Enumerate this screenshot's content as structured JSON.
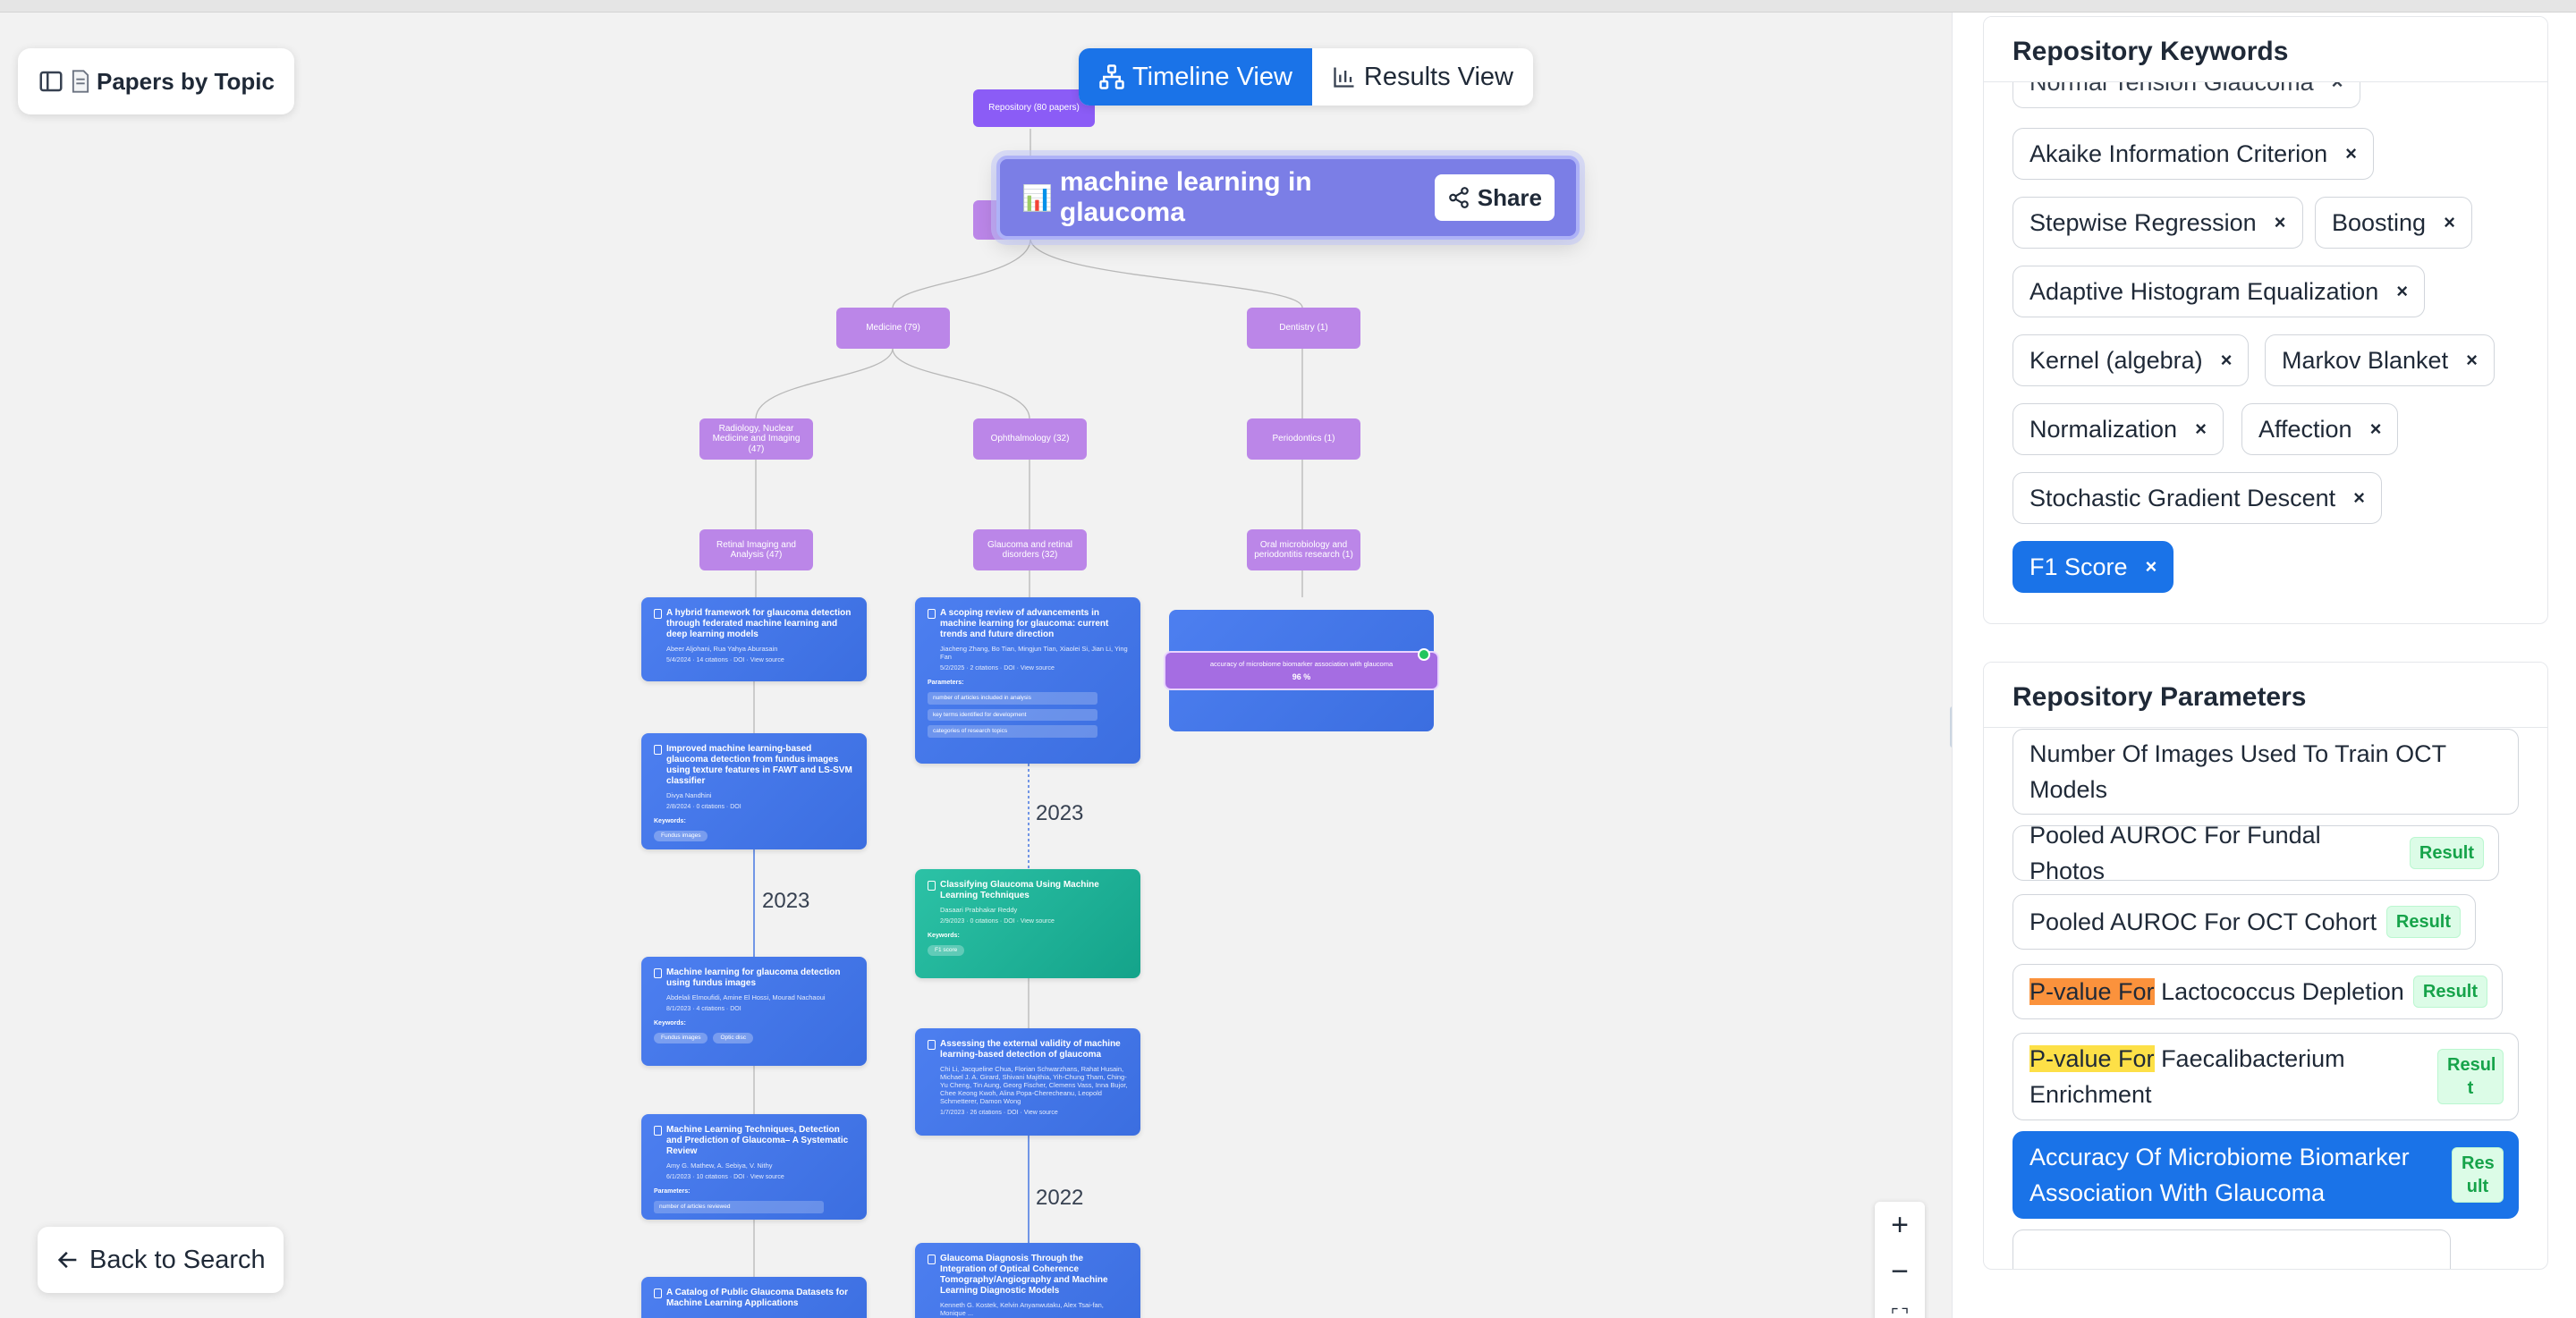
{
  "topic_button": {
    "label": "Papers by Topic"
  },
  "view_toggle": {
    "timeline": "Timeline View",
    "results": "Results View"
  },
  "popup": {
    "icon": "📊",
    "title": "machine learning in glaucoma",
    "share": "Share"
  },
  "tree": {
    "root": "Repository (80 papers)",
    "medicine": "Medicine (79)",
    "dentistry": "Dentistry (1)",
    "radiology": "Radiology, Nuclear Medicine and Imaging (47)",
    "ophthalmology": "Ophthalmology (32)",
    "periodontics": "Periodontics (1)",
    "retinal": "Retinal Imaging and Analysis (47)",
    "glaucoma": "Glaucoma and retinal disorders (32)",
    "oral": "Oral microbiology and periodontitis research (1)"
  },
  "years": [
    "2023",
    "2023",
    "2022"
  ],
  "papers": [
    {
      "title": "A hybrid framework for glaucoma detection through federated machine learning and deep learning models",
      "authors": "Abeer Aljohani, Rua Yahya Aburasain",
      "stats": "5/4/2024 · 14 citations · DOI · View source"
    },
    {
      "title": "Improved machine learning-based glaucoma detection from fundus images using texture features in FAWT and LS-SVM classifier",
      "authors": "Divya Nandhini",
      "stats": "2/8/2024 · 0 citations · DOI",
      "keywords_label": "Keywords:",
      "keywords": [
        "Fundus images"
      ]
    },
    {
      "title": "Machine learning for glaucoma detection using fundus images",
      "authors": "Abdelali Elmoufidi, Amine El Hossi, Mourad Nachaoui",
      "stats": "8/1/2023 · 4 citations · DOI",
      "keywords_label": "Keywords:",
      "keywords": [
        "Fundus images",
        "Optic disc"
      ]
    },
    {
      "title": "Machine Learning Techniques, Detection and Prediction of Glaucoma– A Systematic Review",
      "authors": "Amy G. Mathew, A. Sebiya, V. Nithy",
      "stats": "6/1/2023 · 10 citations · DOI · View source",
      "params_label": "Parameters:",
      "params": [
        "number of articles reviewed"
      ]
    },
    {
      "title": "A Catalog of Public Glaucoma Datasets for Machine Learning Applications"
    },
    {
      "title": "A scoping review of advancements in machine learning for glaucoma: current trends and future direction",
      "authors": "Jiacheng Zhang, Bo Tian, Mingjun Tian, Xiaolei Si, Jian Li, Ying Fan",
      "stats": "5/2/2025 · 2 citations · DOI · View source",
      "params_label": "Parameters:",
      "params": [
        "number of articles included in analysis",
        "key terms identified for development",
        "categories of research topics"
      ]
    },
    {
      "title": "Classifying Glaucoma Using Machine Learning Techniques",
      "authors": "Dasaari Prabhakar Reddy",
      "stats": "2/9/2023 · 0 citations · DOI · View source",
      "keywords_label": "Keywords:",
      "keywords": [
        "F1 score"
      ]
    },
    {
      "title": "Assessing the external validity of machine learning-based detection of glaucoma",
      "authors": "Chi Li, Jacqueline Chua, Florian Schwarzhans, Rahat Husain, Michael J. A. Girard, Shivani Majithia, Yih-Chung Tham, Ching-Yu Cheng, Tin Aung, Georg Fischer, Clemens Vass, Inna Bujor, Chee Keong Kwoh, Alina Popa-Cherecheanu, Leopold Schmetterer, Damon Wong",
      "stats": "1/7/2023 · 26 citations · DOI · View source"
    },
    {
      "title": "Glaucoma Diagnosis Through the Integration of Optical Coherence Tomography/Angiography and Machine Learning Diagnostic Models",
      "authors": "Kenneth G. Kostek, Kelvin Anyanwutaku, Alex Tsai-fan, Monique ..."
    }
  ],
  "result_node": {
    "label": "accuracy of microbiome biomarker association with glaucoma",
    "value": "96 %"
  },
  "zoom": {
    "in": "+",
    "out": "−",
    "fit": "⛶"
  },
  "back": {
    "label": "Back to Search"
  },
  "keywords_panel": {
    "title": "Repository Keywords",
    "partial": "Normal Tension Glaucoma",
    "chips": [
      "Akaike Information Criterion",
      "Stepwise Regression",
      "Boosting",
      "Adaptive Histogram Equalization",
      "Kernel (algebra)",
      "Markov Blanket",
      "Normalization",
      "Affection",
      "Stochastic Gradient Descent",
      "F1 Score"
    ],
    "remove": "×"
  },
  "params_panel": {
    "title": "Repository Parameters",
    "badge": "Result",
    "badge_wrapped": "Resul t",
    "badge_wrapped2": "Res ult",
    "items": [
      {
        "text": "Number Of Images Used To Train OCT Models"
      },
      {
        "text": "Pooled AUROC For Fundal Photos"
      },
      {
        "text": "Pooled AUROC For OCT Cohort"
      },
      {
        "highlight": "P-value For",
        "text": " Lactococcus Depletion"
      },
      {
        "highlight": "P-value For",
        "text": " Faecalibacterium Enrichment"
      },
      {
        "text": "Accuracy Of Microbiome Biomarker Association With Glaucoma"
      }
    ]
  }
}
